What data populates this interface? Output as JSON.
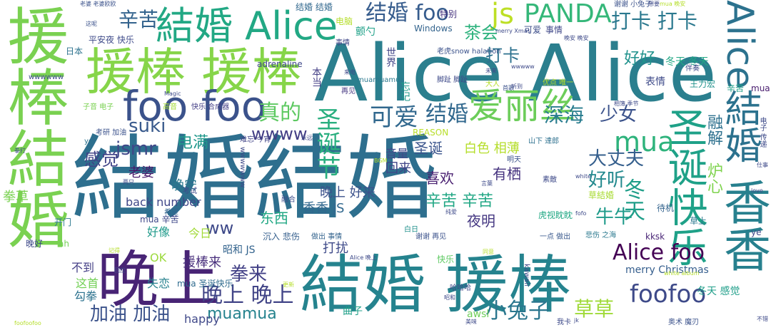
{
  "words": [
    {
      "id": "w1",
      "text": "結婚結婚",
      "color": "#2e6f8e"
    },
    {
      "id": "w2",
      "text": "Alice Alice",
      "color": "#2b7f8e"
    },
    {
      "id": "w3",
      "text": "援棒結婚",
      "color": "#7ad151"
    },
    {
      "id": "w4",
      "text": "援棒 援棒",
      "color": "#86d549"
    },
    {
      "id": "w5",
      "text": "結婚 援棒",
      "color": "#25838e"
    },
    {
      "id": "w6",
      "text": "結婚 Alice",
      "color": "#22a884"
    },
    {
      "id": "w7",
      "text": "晚上",
      "color": "#482475"
    },
    {
      "id": "w8",
      "text": "foo foo",
      "color": "#3b528b"
    },
    {
      "id": "w9",
      "text": "Alice結婚",
      "color": "#2c728e"
    },
    {
      "id": "w10",
      "text": "香香",
      "color": "#27808e"
    },
    {
      "id": "w11",
      "text": "圣诞快乐",
      "color": "#1fa188"
    },
    {
      "id": "w12",
      "text": "PANDA",
      "color": "#35b779"
    },
    {
      "id": "w13",
      "text": "爱丽丝",
      "color": "#6ccd5a"
    },
    {
      "id": "w14",
      "text": "可爱",
      "color": "#31688e"
    },
    {
      "id": "w15",
      "text": "圣诞节",
      "color": "#29af7f"
    },
    {
      "id": "w16",
      "text": "js",
      "color": "#bddf26"
    },
    {
      "id": "w17",
      "text": "结婚 foo",
      "color": "#365c8d"
    },
    {
      "id": "w18",
      "text": "打卡 打卡",
      "color": "#2a788e"
    },
    {
      "id": "w19",
      "text": "辛苦",
      "color": "#33638d"
    },
    {
      "id": "w20",
      "text": "mua",
      "color": "#2eb37c"
    },
    {
      "id": "w21",
      "text": "foofoo",
      "color": "#3e4a89"
    },
    {
      "id": "w22",
      "text": "Alice foo",
      "color": "#440154"
    },
    {
      "id": "w23",
      "text": "真的",
      "color": "#5ec962"
    },
    {
      "id": "w24",
      "text": "结婚",
      "color": "#31688e"
    },
    {
      "id": "w25",
      "text": "jsmr",
      "color": "#3f4788"
    },
    {
      "id": "w26",
      "text": "suki",
      "color": "#38598c"
    },
    {
      "id": "w27",
      "text": "wwww",
      "color": "#433e85"
    },
    {
      "id": "w28",
      "text": "电满",
      "color": "#1f988b"
    },
    {
      "id": "w29",
      "text": "感觉",
      "color": "#404387"
    },
    {
      "id": "w30",
      "text": "拳来",
      "color": "#424086"
    },
    {
      "id": "w31",
      "text": "晚上 晚上",
      "color": "#414487"
    },
    {
      "id": "w32",
      "text": "加油 加油",
      "color": "#3b528b"
    },
    {
      "id": "w33",
      "text": "muamua",
      "color": "#25838e"
    },
    {
      "id": "w34",
      "text": "小兔子",
      "color": "#2a768e"
    },
    {
      "id": "w35",
      "text": "草草",
      "color": "#a0da39"
    },
    {
      "id": "w36",
      "text": "深海",
      "color": "#287c8e"
    },
    {
      "id": "w37",
      "text": "少女",
      "color": "#3b528b"
    },
    {
      "id": "w38",
      "text": "大丈夫",
      "color": "#355f8d"
    },
    {
      "id": "w39",
      "text": "好听",
      "color": "#23898e"
    },
    {
      "id": "w40",
      "text": "牛牛",
      "color": "#1e9b8a"
    },
    {
      "id": "w41",
      "text": "ww",
      "color": "#3e4989"
    },
    {
      "id": "w42",
      "text": "好好",
      "color": "#20928c"
    },
    {
      "id": "w43",
      "text": "打卡",
      "color": "#2d718e"
    },
    {
      "id": "w44",
      "text": "茶会",
      "color": "#2db27d"
    },
    {
      "id": "w45",
      "text": "冬天",
      "color": "#1f9e89"
    },
    {
      "id": "w46",
      "text": "融解",
      "color": "#2d708e"
    },
    {
      "id": "w47",
      "text": "炉心",
      "color": "#7fd34e"
    },
    {
      "id": "w48",
      "text": "夜明",
      "color": "#453882"
    },
    {
      "id": "w49",
      "text": "喜欢",
      "color": "#481f70"
    },
    {
      "id": "w50",
      "text": "有栖",
      "color": "#46337f"
    },
    {
      "id": "w51",
      "text": "圣诞",
      "color": "#3a548c"
    },
    {
      "id": "w52",
      "text": "回来",
      "color": "#404588"
    },
    {
      "id": "w53",
      "text": "白色 相薄",
      "color": "#b5de2b"
    },
    {
      "id": "w54",
      "text": "音量",
      "color": "#3f4889"
    },
    {
      "id": "w55",
      "text": "晚上 好来",
      "color": "#3b518b"
    },
    {
      "id": "w56",
      "text": "辛苦 辛苦",
      "color": "#22a785"
    },
    {
      "id": "w57",
      "text": "香香 JS",
      "color": "#31688e"
    },
    {
      "id": "w58",
      "text": "打扰",
      "color": "#3e4a89"
    },
    {
      "id": "w59",
      "text": "东西",
      "color": "#22a884"
    },
    {
      "id": "w60",
      "text": "back number",
      "color": "#3f4788"
    },
    {
      "id": "w61",
      "text": "老婆",
      "color": "#48196b"
    },
    {
      "id": "w62",
      "text": "晚安",
      "color": "#2a788e"
    },
    {
      "id": "w63",
      "text": "拳草",
      "color": "#7ad151"
    },
    {
      "id": "w64",
      "text": "援棒来",
      "color": "#472d7b"
    },
    {
      "id": "w65",
      "text": "昭和 JS",
      "color": "#33638d"
    },
    {
      "id": "w66",
      "text": "不到",
      "color": "#433e85"
    },
    {
      "id": "w67",
      "text": "这首",
      "color": "#73d056"
    },
    {
      "id": "w68",
      "text": "勾拳",
      "color": "#2c728e"
    },
    {
      "id": "w69",
      "text": "失恋",
      "color": "#26818e"
    },
    {
      "id": "w70",
      "text": "OK",
      "color": "#9bd93c"
    },
    {
      "id": "w71",
      "text": "好像",
      "color": "#1f9a8a"
    },
    {
      "id": "w72",
      "text": "今日",
      "color": "#a2da37"
    },
    {
      "id": "w73",
      "text": "mua 辛苦",
      "color": "#3f4889"
    },
    {
      "id": "w74",
      "text": "mua 圣诞快乐",
      "color": "#2f6b8e"
    },
    {
      "id": "w75",
      "text": "happy",
      "color": "#3f4889"
    },
    {
      "id": "w76",
      "text": "曲子",
      "color": "#1f9f88"
    },
    {
      "id": "w77",
      "text": "awsl",
      "color": "#6ece58"
    },
    {
      "id": "w78",
      "text": "merry Christmas",
      "color": "#355e8d"
    },
    {
      "id": "w79",
      "text": "冬天 感觉",
      "color": "#1f9e89"
    },
    {
      "id": "w80",
      "text": "Windows",
      "color": "#33638d"
    },
    {
      "id": "w81",
      "text": "平安夜 快乐",
      "color": "#3e4a89"
    },
    {
      "id": "w82",
      "text": "日本",
      "color": "#2c728e"
    },
    {
      "id": "w83",
      "text": "电脑",
      "color": "#b5de2b"
    },
    {
      "id": "w84",
      "text": "颤勺",
      "color": "#1fa188"
    },
    {
      "id": "w85",
      "text": "特别",
      "color": "#46327e"
    },
    {
      "id": "w86",
      "text": "可爱",
      "color": "#3d4e8a"
    },
    {
      "id": "w87",
      "text": "事情",
      "color": "#3f4788"
    },
    {
      "id": "w88",
      "text": "冬天 冬天",
      "color": "#22a884"
    },
    {
      "id": "w89",
      "text": "表情",
      "color": "#3e4a89"
    },
    {
      "id": "w90",
      "text": "王力宏",
      "color": "#20928c"
    },
    {
      "id": "w91",
      "text": "辛苦",
      "color": "#1f9f88"
    },
    {
      "id": "w92",
      "text": "mua",
      "color": "#481c6e"
    },
    {
      "id": "w93",
      "text": "adrenaline",
      "color": "#3f4889"
    },
    {
      "id": "w94",
      "text": "快乐 合成器",
      "color": "#433e85"
    },
    {
      "id": "w95",
      "text": "难忘 今宵",
      "color": "#404387"
    },
    {
      "id": "w96",
      "text": "子音 电子",
      "color": "#7ad151"
    },
    {
      "id": "w97",
      "text": "高音",
      "color": "#a5db36"
    },
    {
      "id": "w98",
      "text": "老虎snow halation",
      "color": "#3b528b"
    },
    {
      "id": "w99",
      "text": "muamuamua",
      "color": "#2a788e"
    },
    {
      "id": "w100",
      "text": "再见",
      "color": "#453781"
    },
    {
      "id": "w101",
      "text": "REASON",
      "color": "#b8de29"
    },
    {
      "id": "w102",
      "text": "山下 達郎",
      "color": "#2d708e"
    },
    {
      "id": "w103",
      "text": "考研 加油",
      "color": "#3b528b"
    },
    {
      "id": "w104",
      "text": "考试",
      "color": "#3e4a89"
    },
    {
      "id": "w105",
      "text": "希望",
      "color": "#32648e"
    },
    {
      "id": "w106",
      "text": "沉入 悲伤",
      "color": "#355f8d"
    },
    {
      "id": "w107",
      "text": "做出 事情",
      "color": "#33638d"
    },
    {
      "id": "w108",
      "text": "一点 做出",
      "color": "#38588c"
    },
    {
      "id": "w109",
      "text": "谢谢 再见",
      "color": "#3b528b"
    },
    {
      "id": "w110",
      "text": "虎视眈眈",
      "color": "#22a884"
    },
    {
      "id": "w111",
      "text": "悲伤 之海",
      "color": "#2a788e"
    },
    {
      "id": "w112",
      "text": "kksk",
      "color": "#482475"
    },
    {
      "id": "w113",
      "text": "待机",
      "color": "#33638d"
    },
    {
      "id": "w114",
      "text": "草上",
      "color": "#2a788e"
    },
    {
      "id": "w115",
      "text": "ye",
      "color": "#3f4889"
    },
    {
      "id": "w116",
      "text": "白日",
      "color": "#21918c"
    },
    {
      "id": "w117",
      "text": "明天",
      "color": "#3b528b"
    },
    {
      "id": "w118",
      "text": "草結婚",
      "color": "#a8db34"
    },
    {
      "id": "w119",
      "text": "开门",
      "color": "#2a788e"
    },
    {
      "id": "w120",
      "text": "晚好",
      "color": "#3e4a89"
    },
    {
      "id": "w121",
      "text": "ah",
      "color": "#73d056"
    },
    {
      "id": "w122",
      "text": "哈哈哈",
      "color": "#3e4989"
    },
    {
      "id": "w123",
      "text": "yo",
      "color": "#2c728e"
    },
    {
      "id": "w124",
      "text": "快乐",
      "color": "#5ec962"
    },
    {
      "id": "w125",
      "text": "融合",
      "color": "#3d4e8a"
    },
    {
      "id": "w126",
      "text": "素敵",
      "color": "#3e4a89"
    },
    {
      "id": "w127",
      "text": "本当",
      "color": "#433e85"
    },
    {
      "id": "w128",
      "text": "世界",
      "color": "#404387"
    },
    {
      "id": "w129",
      "text": "忘记",
      "color": "#1f998a"
    },
    {
      "id": "w130",
      "text": "伴奏",
      "color": "#3e4a89"
    },
    {
      "id": "w131",
      "text": "事情",
      "color": "#3f4788"
    },
    {
      "id": "w132",
      "text": "老婆 老婆欧欧",
      "color": "#3b528b"
    },
    {
      "id": "w133",
      "text": "这呢",
      "color": "#3b528b"
    },
    {
      "id": "w134",
      "text": "结婚 结婚",
      "color": "#31688e"
    },
    {
      "id": "w135",
      "text": "优点 唯一",
      "color": "#b5de2b"
    },
    {
      "id": "w136",
      "text": "大人",
      "color": "#b5de2b"
    },
    {
      "id": "w137",
      "text": "首歌",
      "color": "#3b528b"
    },
    {
      "id": "w138",
      "text": "未来",
      "color": "#3e4a89"
    },
    {
      "id": "w139",
      "text": "谢谢 小兔子",
      "color": "#3b528b"
    },
    {
      "id": "w140",
      "text": "merry Xmas",
      "color": "#3e4a89"
    },
    {
      "id": "w141",
      "text": "晚安 晚安",
      "color": "#3e4a89"
    },
    {
      "id": "w142",
      "text": "mua 晚安",
      "color": "#b5de2b"
    },
    {
      "id": "w143",
      "text": "想要",
      "color": "#3e4a89"
    },
    {
      "id": "w144",
      "text": "电子 传递",
      "color": "#3e4a89"
    },
    {
      "id": "w145",
      "text": "wwwwww",
      "color": "#3e4a89"
    },
    {
      "id": "w146",
      "text": "wwwwwww",
      "color": "#3e4a89"
    },
    {
      "id": "w147",
      "text": "永远",
      "color": "#3e4a89"
    },
    {
      "id": "w148",
      "text": "Magic",
      "color": "#3e4a89"
    },
    {
      "id": "w149",
      "text": "white album",
      "color": "#b5de2b"
    },
    {
      "id": "w150",
      "text": "love",
      "color": "#3e4a89"
    },
    {
      "id": "w151",
      "text": "奥术 魔刃",
      "color": "#3b528b"
    },
    {
      "id": "w152",
      "text": "不错",
      "color": "#3e4a89"
    },
    {
      "id": "w153",
      "text": "我卡",
      "color": "#3e4a89"
    },
    {
      "id": "w154",
      "text": "jk",
      "color": "#3e4a89"
    },
    {
      "id": "w155",
      "text": "美味",
      "color": "#3e4a89"
    },
    {
      "id": "w156",
      "text": "更新",
      "color": "#b5de2b"
    },
    {
      "id": "w157",
      "text": "昭和",
      "color": "#3e4a89"
    },
    {
      "id": "w158",
      "text": "kawaii",
      "color": "#3e4a89"
    },
    {
      "id": "w159",
      "text": "fofo",
      "color": "#3e4a89"
    },
    {
      "id": "w160",
      "text": "white",
      "color": "#3e4a89"
    },
    {
      "id": "w161",
      "text": "BGM",
      "color": "#b5de2b"
    },
    {
      "id": "w162",
      "text": "两只",
      "color": "#3e4a89"
    },
    {
      "id": "w163",
      "text": "记得",
      "color": "#b5de2b"
    },
    {
      "id": "w164",
      "text": "拳打",
      "color": "#3e4a89"
    },
    {
      "id": "w165",
      "text": "仕事",
      "color": "#3e4a89"
    },
    {
      "id": "w166",
      "text": "来电",
      "color": "#3e4a89"
    },
    {
      "id": "w167",
      "text": "脚趾 脚趾",
      "color": "#3e4a89"
    },
    {
      "id": "w168",
      "text": "听到",
      "color": "#3e4a89"
    },
    {
      "id": "w169",
      "text": "相簿 季节",
      "color": "#3e4a89"
    },
    {
      "id": "w170",
      "text": "wwwww",
      "color": "#3e4a89"
    },
    {
      "id": "w171",
      "text": "foofoofoo",
      "color": "#b5de2b"
    },
    {
      "id": "w172",
      "text": "言葉",
      "color": "#3e4a89"
    },
    {
      "id": "w173",
      "text": "纯爱",
      "color": "#3e4a89"
    },
    {
      "id": "w174",
      "text": "Alice 晚上",
      "color": "#3e4a89"
    },
    {
      "id": "w175",
      "text": "回应",
      "color": "#3e4a89"
    },
    {
      "id": "w176",
      "text": "同意",
      "color": "#b5de2b"
    }
  ]
}
